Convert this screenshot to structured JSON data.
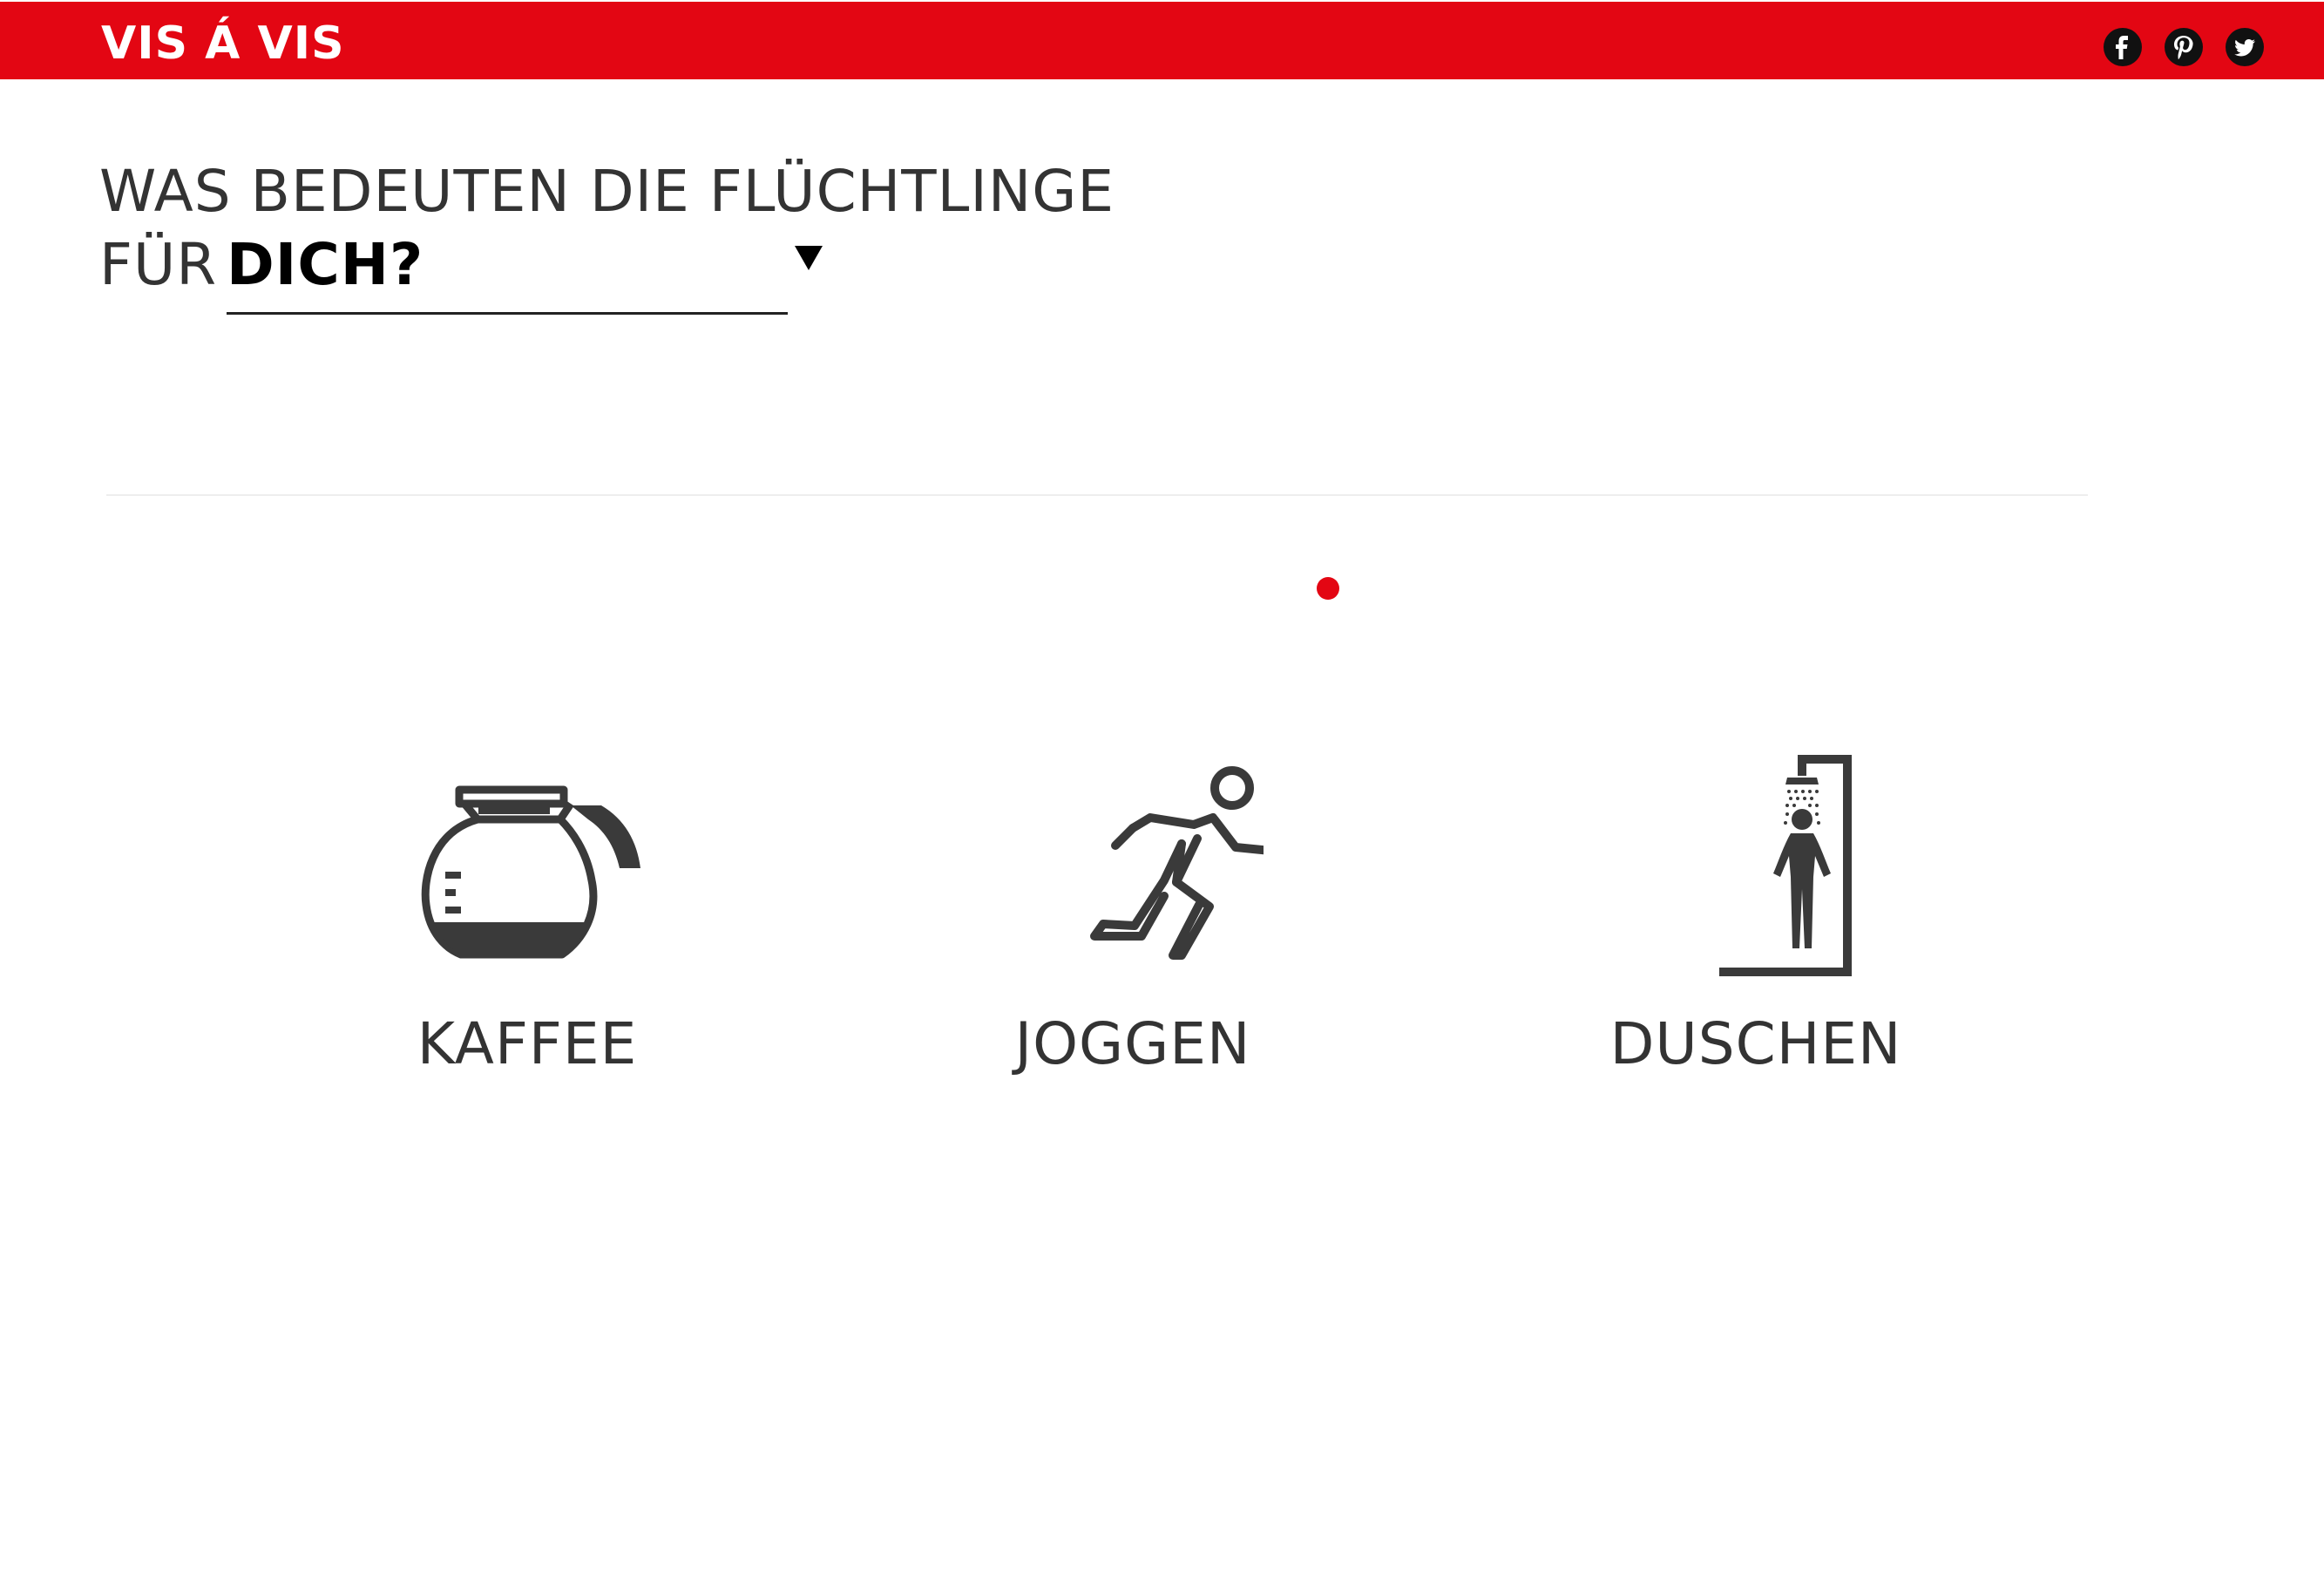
{
  "header": {
    "logo": "VIS Á VIS",
    "brand_color": "#e30613",
    "social_icons": [
      "facebook-icon",
      "pinterest-icon",
      "twitter-icon"
    ]
  },
  "question": {
    "line1": "WAS BEDEUTEN DIE FLÜCHTLINGE",
    "line2_prefix": "FÜR",
    "selected_value": "DICH?"
  },
  "activities": [
    {
      "label": "KAFFEE",
      "icon": "coffee-pot-icon"
    },
    {
      "label": "JOGGEN",
      "icon": "runner-icon"
    },
    {
      "label": "DUSCHEN",
      "icon": "shower-icon"
    }
  ],
  "colors": {
    "accent": "#e30613",
    "text": "#333333",
    "icon": "#3a3a3a"
  }
}
